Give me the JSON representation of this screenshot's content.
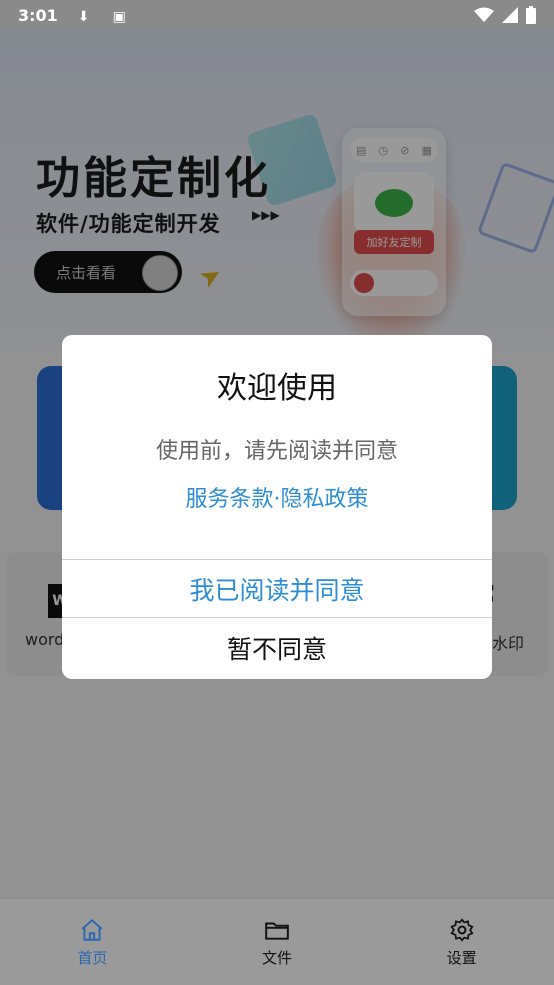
{
  "status_bar": {
    "time": "3:01",
    "icons_left": [
      "download-icon",
      "a-icon"
    ],
    "icons_right": [
      "wifi-icon",
      "signal-icon",
      "battery-icon"
    ]
  },
  "banner": {
    "title": "功能定制化",
    "subtitle": "软件/功能定制开发",
    "cta_label": "点击看看",
    "phone_button_label": "加好友定制"
  },
  "tools": {
    "left_label": "word",
    "right_label": "水印"
  },
  "dialog": {
    "title": "欢迎使用",
    "message": "使用前，请先阅读并同意",
    "terms_link": "服务条款",
    "separator": "·",
    "privacy_link": "隐私政策",
    "agree_label": "我已阅读并同意",
    "decline_label": "暂不同意"
  },
  "bottom_nav": {
    "items": [
      {
        "label": "首页",
        "icon": "home-icon",
        "active": true
      },
      {
        "label": "文件",
        "icon": "folder-icon",
        "active": false
      },
      {
        "label": "设置",
        "icon": "gear-icon",
        "active": false
      }
    ]
  },
  "colors": {
    "accent": "#2e8dd6",
    "nav_active": "#2b67b2"
  }
}
